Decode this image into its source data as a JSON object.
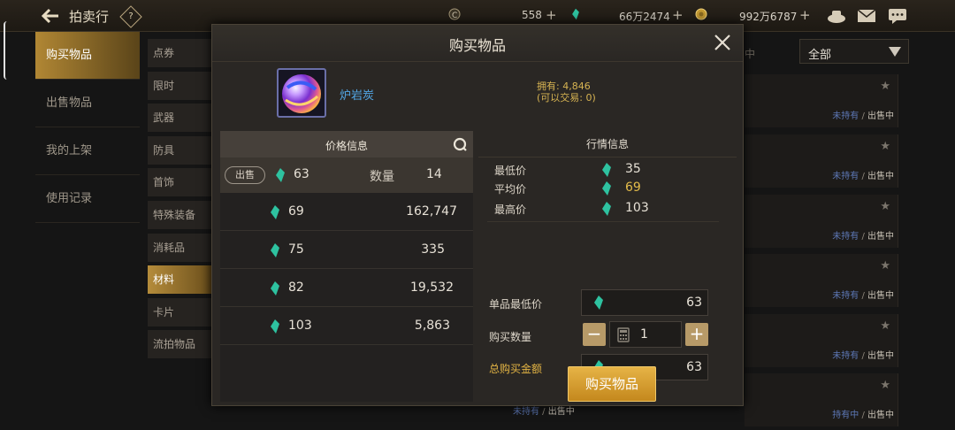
{
  "topbar": {
    "title": "拍卖行",
    "help": "?",
    "currency1": "558",
    "currency2": "66万2474",
    "currency3": "992万6787"
  },
  "sidebar": {
    "items": [
      {
        "label": "购买物品",
        "active": true
      },
      {
        "label": "出售物品"
      },
      {
        "label": "我的上架"
      },
      {
        "label": "使用记录"
      }
    ]
  },
  "categories": [
    "点券",
    "限时",
    "武器",
    "防具",
    "首饰",
    "特殊装备",
    "消耗品",
    "材料",
    "卡片",
    "流拍物品"
  ],
  "active_category": "材料",
  "right_list": {
    "filter": "全部",
    "header_fragment": "中",
    "rows": [
      {
        "status_a": "未持有",
        "status_b": "出售中"
      },
      {
        "status_a": "未持有",
        "status_b": "出售中"
      },
      {
        "status_a": "未持有",
        "status_b": "出售中"
      },
      {
        "status_a": "未持有",
        "status_b": "出售中"
      },
      {
        "status_a": "未持有",
        "status_b": "出售中"
      },
      {
        "status_a": "持有中",
        "status_b": "出售中"
      }
    ],
    "under_modal_status": {
      "a": "未持有",
      "b": "出售中"
    }
  },
  "modal": {
    "title": "购买物品",
    "item_name": "炉岩炭",
    "owned_line1": "拥有: 4,846",
    "owned_line2": "(可以交易: 0)",
    "price_panel": {
      "header": "价格信息",
      "sell_label": "出售",
      "sell_price": "63",
      "qty_label": "数量",
      "sell_qty": "14",
      "rows": [
        {
          "price": "69",
          "qty": "162,747"
        },
        {
          "price": "75",
          "qty": "335"
        },
        {
          "price": "82",
          "qty": "19,532"
        },
        {
          "price": "103",
          "qty": "5,863"
        }
      ]
    },
    "market_panel": {
      "header": "行情信息",
      "min_label": "最低价",
      "min_value": "35",
      "avg_label": "平均价",
      "avg_value": "69",
      "max_label": "最高价",
      "max_value": "103"
    },
    "purchase": {
      "unit_min_label": "单品最低价",
      "unit_min_value": "63",
      "qty_label": "购买数量",
      "qty_value": "1",
      "minus": "−",
      "plus": "+",
      "total_label": "总购买金额",
      "total_value": "63"
    },
    "buy_button": "购买物品"
  },
  "colors": {
    "accent": "#c4881d",
    "gem": "#2ec2a0",
    "link_blue": "#5d78b6",
    "gold_text": "#d6b352"
  }
}
